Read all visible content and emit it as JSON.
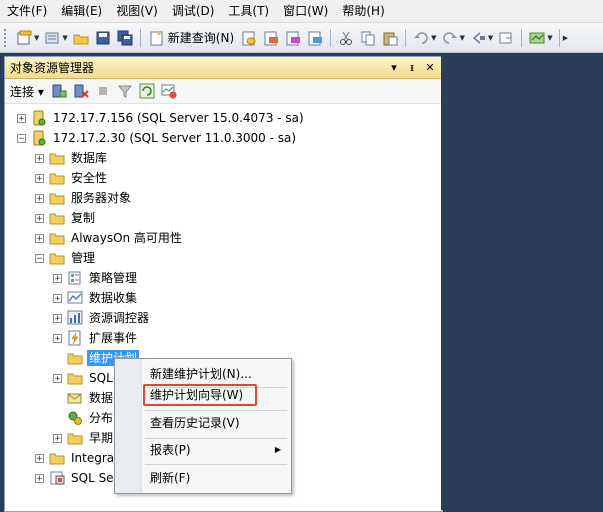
{
  "menu": [
    "文件(F)",
    "编辑(E)",
    "视图(V)",
    "调试(D)",
    "工具(T)",
    "窗口(W)",
    "帮助(H)"
  ],
  "toolbar": {
    "new_query_label": "新建查询(N)"
  },
  "panel": {
    "title": "对象资源管理器",
    "pin_glyph": "▾",
    "autohide_glyph": "ᵻ",
    "close_glyph": "✕",
    "connect_label": "连接 ▾"
  },
  "tree": [
    {
      "label": "172.17.7.156 (SQL Server 15.0.4073 - sa)",
      "exp": "+",
      "icon": "server-icon"
    },
    {
      "label": "172.17.2.30 (SQL Server 11.0.3000 - sa)",
      "exp": "−",
      "icon": "server-icon"
    },
    {
      "label": "数据库",
      "exp": "+",
      "icon": "folder-icon"
    },
    {
      "label": "安全性",
      "exp": "+",
      "icon": "folder-icon"
    },
    {
      "label": "服务器对象",
      "exp": "+",
      "icon": "folder-icon"
    },
    {
      "label": "复制",
      "exp": "+",
      "icon": "folder-icon"
    },
    {
      "label": "AlwaysOn 高可用性",
      "exp": "+",
      "icon": "folder-icon"
    },
    {
      "label": "管理",
      "exp": "−",
      "icon": "folder-icon"
    },
    {
      "label": "策略管理",
      "exp": "+",
      "icon": "policy-icon"
    },
    {
      "label": "数据收集",
      "exp": "+",
      "icon": "data-collection-icon"
    },
    {
      "label": "资源调控器",
      "exp": "+",
      "icon": "resource-governor-icon"
    },
    {
      "label": "扩展事件",
      "exp": "+",
      "icon": "extended-events-icon"
    },
    {
      "label": "维护计划",
      "exp": "",
      "icon": "folder-icon"
    },
    {
      "label": "SQL",
      "exp": "+",
      "icon": "folder-icon"
    },
    {
      "label": "数据",
      "exp": "",
      "icon": "database-mail-icon"
    },
    {
      "label": "分布",
      "exp": "",
      "icon": "dtc-icon"
    },
    {
      "label": "早期",
      "exp": "+",
      "icon": "folder-icon"
    },
    {
      "label": "Integrat",
      "exp": "+",
      "icon": "folder-icon"
    },
    {
      "label": "SQL Ser",
      "exp": "+",
      "icon": "agent-icon"
    }
  ],
  "context_menu": {
    "new_plan": "新建维护计划(N)...",
    "wizard": "维护计划向导(W)",
    "history": "查看历史记录(V)",
    "reports": "报表(P)",
    "reports_arrow": "▶",
    "refresh": "刷新(F)"
  },
  "colors": {
    "highlight_border": "#e4472f",
    "selection": "#3399ff",
    "title_bar": "#f2dc8c",
    "background": "#2b3c59"
  }
}
